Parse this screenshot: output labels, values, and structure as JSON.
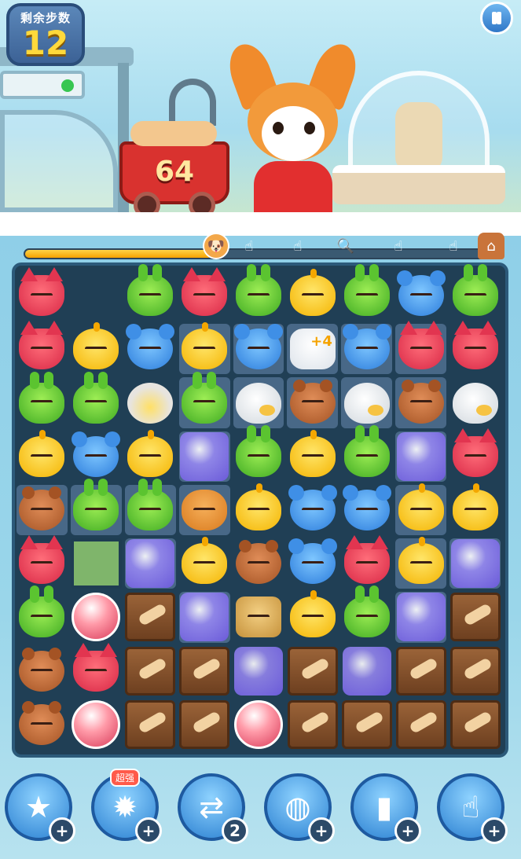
{
  "hud": {
    "moves_label": "剩余步数",
    "moves_value": "12",
    "pause_icon": "pause-icon"
  },
  "scene": {
    "cart_count": "64"
  },
  "progress": {
    "fraction": 0.4,
    "milestones": [
      "corgi-avatar-icon",
      "glove-icon",
      "glove-icon",
      "magnifier-icon",
      "glove-icon",
      "glove-icon",
      "dog-house-icon"
    ]
  },
  "board": {
    "rows": [
      [
        "fox",
        "empty",
        "bun",
        "fox",
        "bun",
        "chk",
        "bun",
        "mou",
        "bun"
      ],
      [
        "fox",
        "chk",
        "mou",
        "chk",
        "mou",
        "glove",
        "mou",
        "fox",
        "fox"
      ],
      [
        "bun",
        "bun",
        "cracked",
        "bun",
        "egg",
        "bear",
        "egg",
        "bear",
        "egg"
      ],
      [
        "chk",
        "mou",
        "chk",
        "bubble",
        "bun",
        "chk",
        "bun",
        "bubble",
        "fox"
      ],
      [
        "bear",
        "bun",
        "bun",
        "dogpc",
        "chk",
        "mou",
        "mou",
        "chk",
        "chk"
      ],
      [
        "fox",
        "hole",
        "bubble",
        "chk",
        "bear",
        "mou",
        "fox",
        "chk",
        "bubble"
      ],
      [
        "bun",
        "capsule",
        "crate",
        "bubble",
        "bulldog",
        "chk",
        "bun",
        "bubble",
        "crate"
      ],
      [
        "bear",
        "fox",
        "crate",
        "crate",
        "bubble",
        "crate",
        "bubble",
        "crate",
        "crate"
      ],
      [
        "bear",
        "capsule",
        "crate",
        "crate",
        "capsule",
        "crate",
        "crate",
        "crate",
        "crate"
      ]
    ],
    "glove_bonus": "+4"
  },
  "tools": [
    {
      "icon": "star-wand-icon",
      "badge": "+"
    },
    {
      "icon": "hammer-cannon-icon",
      "badge": "+",
      "tag": "超强"
    },
    {
      "icon": "swap-arrows-icon",
      "badge": "2"
    },
    {
      "icon": "goggles-icon",
      "badge": "+"
    },
    {
      "icon": "paint-roller-icon",
      "badge": "+"
    },
    {
      "icon": "glove-undo-icon",
      "badge": "+"
    }
  ]
}
